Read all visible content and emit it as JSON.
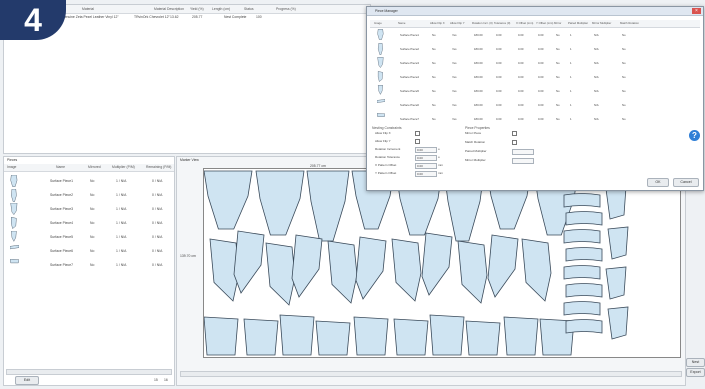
{
  "step_badge": "4",
  "order_table": {
    "columns": [
      "Material",
      "Material Description",
      "Yield (%)",
      "Length (cm)",
      "Status",
      "Progress (%)"
    ],
    "rows": [
      [
        "Genuine Zeta Pezel Leather Vinyl 12\"",
        "TRvinOrk Chevrolet 12\"",
        "13.62",
        "205.77",
        "Nest Complete",
        "100"
      ]
    ]
  },
  "pieces_panel": {
    "title": "Pieces",
    "columns": [
      "Image",
      "Name",
      "Mirrored",
      "Multiplier (P/M)",
      "Remaining (P/M)"
    ],
    "rows": [
      {
        "name": "Surface Piece1",
        "mirrored": "No",
        "multiplier": "1 / N/A",
        "remaining": "0 / N/A"
      },
      {
        "name": "Surface Piece2",
        "mirrored": "No",
        "multiplier": "1 / N/A",
        "remaining": "0 / N/A"
      },
      {
        "name": "Surface Piece3",
        "mirrored": "No",
        "multiplier": "1 / N/A",
        "remaining": "0 / N/A"
      },
      {
        "name": "Surface Piece4",
        "mirrored": "No",
        "multiplier": "1 / N/A",
        "remaining": "0 / N/A"
      },
      {
        "name": "Surface Piece5",
        "mirrored": "No",
        "multiplier": "1 / N/A",
        "remaining": "0 / N/A"
      },
      {
        "name": "Surface Piece6",
        "mirrored": "No",
        "multiplier": "1 / N/A",
        "remaining": "0 / N/A"
      },
      {
        "name": "Surface Piece7",
        "mirrored": "No",
        "multiplier": "1 / N/A",
        "remaining": "0 / N/A"
      }
    ],
    "edit_button": "Edit",
    "footer_counts": [
      "15",
      "16"
    ]
  },
  "marker_view": {
    "title": "Marker View",
    "top_label": "205.77 cm",
    "left_label": "139.70 cm"
  },
  "dialog": {
    "title": "Piece Manager",
    "columns": [
      "Image",
      "Name",
      "Allow Flip X",
      "Allow Flip Y",
      "Rotation Incr. (0)",
      "Tolerance (0)",
      "X Offset (mm)",
      "Y Offset (mm)",
      "Mirror",
      "Paired Multiplier",
      "Mirror Multiplier",
      "Match Rotation"
    ],
    "rows": [
      {
        "name": "Surface Piece1",
        "fx": "No",
        "fy": "Yes",
        "rot": "180.00",
        "tol": "0.00",
        "xo": "0.00",
        "yo": "0.00",
        "mirror": "No",
        "pm": "1",
        "mm": "N/A",
        "mr": "No"
      },
      {
        "name": "Surface Piece2",
        "fx": "No",
        "fy": "Yes",
        "rot": "180.00",
        "tol": "0.00",
        "xo": "0.00",
        "yo": "0.00",
        "mirror": "No",
        "pm": "1",
        "mm": "N/A",
        "mr": "No"
      },
      {
        "name": "Surface Piece3",
        "fx": "No",
        "fy": "Yes",
        "rot": "180.00",
        "tol": "0.00",
        "xo": "0.00",
        "yo": "0.00",
        "mirror": "No",
        "pm": "1",
        "mm": "N/A",
        "mr": "No"
      },
      {
        "name": "Surface Piece4",
        "fx": "No",
        "fy": "Yes",
        "rot": "180.00",
        "tol": "0.00",
        "xo": "0.00",
        "yo": "0.00",
        "mirror": "No",
        "pm": "1",
        "mm": "N/A",
        "mr": "No"
      },
      {
        "name": "Surface Piece5",
        "fx": "No",
        "fy": "Yes",
        "rot": "180.00",
        "tol": "0.00",
        "xo": "0.00",
        "yo": "0.00",
        "mirror": "No",
        "pm": "1",
        "mm": "N/A",
        "mr": "No"
      },
      {
        "name": "Surface Piece6",
        "fx": "No",
        "fy": "Yes",
        "rot": "180.00",
        "tol": "0.00",
        "xo": "0.00",
        "yo": "0.00",
        "mirror": "No",
        "pm": "1",
        "mm": "N/A",
        "mr": "No"
      },
      {
        "name": "Surface Piece7",
        "fx": "No",
        "fy": "Yes",
        "rot": "180.00",
        "tol": "0.00",
        "xo": "0.00",
        "yo": "0.00",
        "mirror": "No",
        "pm": "1",
        "mm": "N/A",
        "mr": "No"
      }
    ],
    "nesting_title": "Nesting Constraints",
    "nesting_fields": [
      {
        "label": "Allow Flip X",
        "value": ""
      },
      {
        "label": "Allow Flip Y",
        "value": ""
      },
      {
        "label": "Rotation Increment",
        "value": "0.00",
        "unit": "o"
      },
      {
        "label": "Rotation Tolerance",
        "value": "0.00",
        "unit": "o"
      },
      {
        "label": "X Pattern Offset",
        "value": "0.00",
        "unit": "mm"
      },
      {
        "label": "Y Pattern Offset",
        "value": "0.00",
        "unit": "mm"
      }
    ],
    "piece_title": "Piece Properties",
    "piece_fields": [
      {
        "label": "Mirror Piece"
      },
      {
        "label": "Match Rotation"
      },
      {
        "label": "Paired Multiplier"
      },
      {
        "label": "Mirror Multiplier"
      }
    ],
    "ok_label": "OK",
    "cancel_label": "Cancel",
    "help_glyph": "?"
  },
  "right_buttons": [
    "Nest",
    "Export"
  ],
  "colors": {
    "badge": "#233a6b",
    "piece_fill": "#cfe4f2",
    "piece_stroke": "#3a4a5a",
    "help": "#2f7fd6"
  }
}
